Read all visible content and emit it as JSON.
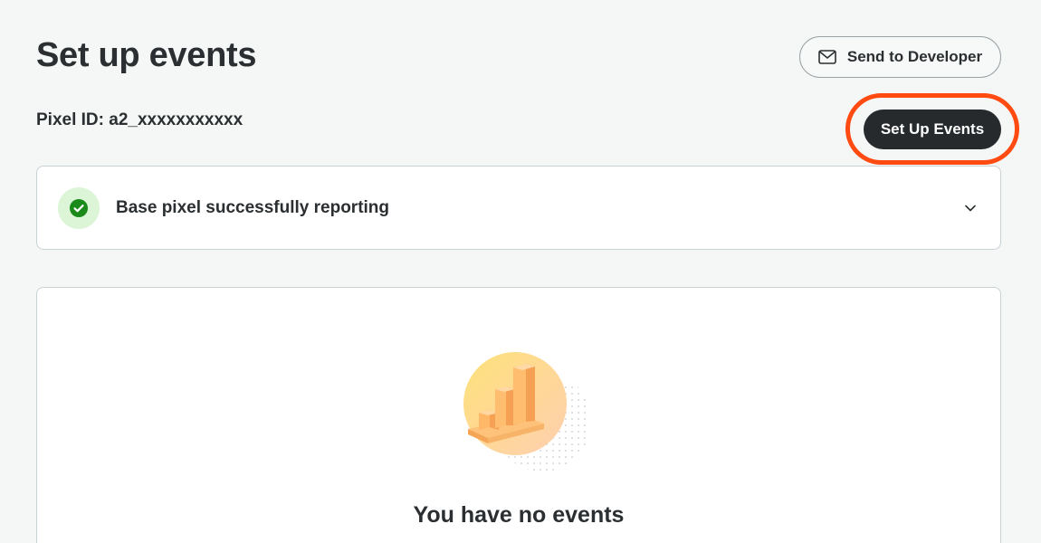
{
  "header": {
    "title": "Set up events",
    "send_button_label": "Send to Developer",
    "send_button_icon": "mail-icon"
  },
  "pixel": {
    "label": "Pixel ID: a2_xxxxxxxxxxx"
  },
  "setup_button": {
    "label": "Set Up Events",
    "highlight_color": "#ff4b12"
  },
  "status_card": {
    "text": "Base pixel successfully reporting",
    "icon": "check-circle-icon",
    "status_color": "#1a8a1a",
    "expand_icon": "chevron-down-icon"
  },
  "events_card": {
    "empty_title": "You have no events",
    "illustration": "bar-chart-illustration"
  },
  "colors": {
    "accent_dark": "#262a2d",
    "background": "#f5f6f6",
    "card_border": "#c8d2d4"
  }
}
